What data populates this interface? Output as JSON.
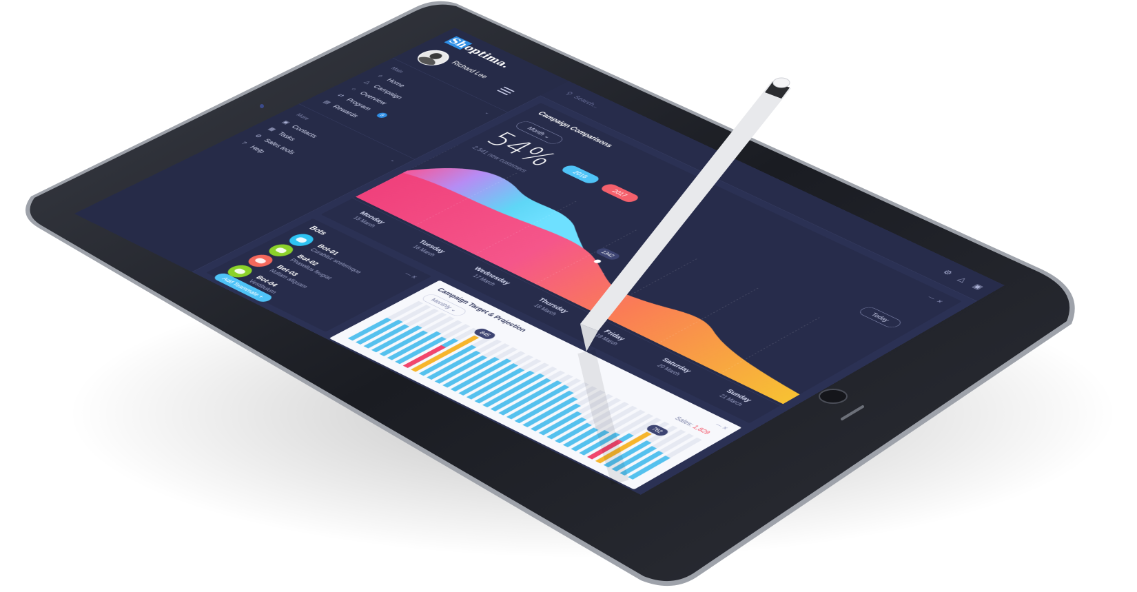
{
  "app": {
    "logo_prefix": "Sh",
    "logo_suffix": "optima.",
    "user_name": "Richard Lee"
  },
  "search": {
    "placeholder": "Search..."
  },
  "sidebar": {
    "main_label": "Main",
    "main_items": [
      {
        "label": "Home",
        "icon": "home-icon"
      },
      {
        "label": "Campaign",
        "icon": "megaphone-icon"
      },
      {
        "label": "Overview",
        "icon": "chat-icon"
      },
      {
        "label": "Program",
        "icon": "program-icon",
        "badge": "9"
      },
      {
        "label": "Rewards",
        "icon": "rewards-icon"
      }
    ],
    "more_label": "More",
    "more_items": [
      {
        "label": "Contacts",
        "icon": "folder-icon"
      },
      {
        "label": "Tasks",
        "icon": "tasks-icon"
      },
      {
        "label": "Sales tools",
        "icon": "tools-icon"
      },
      {
        "label": "Help",
        "icon": "help-icon"
      }
    ]
  },
  "comparison": {
    "title": "Campaign Comparisons",
    "period": "Month",
    "percent": "54%",
    "subtitle": "2,541 new customers",
    "legend_a": "2016",
    "legend_b": "2017",
    "point_label": "1342",
    "today_label": "Today",
    "days": [
      {
        "name": "Monday",
        "date": "15 March"
      },
      {
        "name": "Tuesday",
        "date": "16 March"
      },
      {
        "name": "Wednesday",
        "date": "17 March"
      },
      {
        "name": "Thursday",
        "date": "18 March"
      },
      {
        "name": "Friday",
        "date": "19 March"
      },
      {
        "name": "Saturday",
        "date": "20 March"
      },
      {
        "name": "Sunday",
        "date": "21 March"
      }
    ]
  },
  "bots": {
    "title": "Bots",
    "items": [
      {
        "name": "Bot-01",
        "desc": "Curabitur scelerisque",
        "color": "#2ec2f2"
      },
      {
        "name": "Bot-02",
        "desc": "Phasellus feugiat",
        "color": "#8bd12a"
      },
      {
        "name": "Bot-03",
        "desc": "Nullam aliquam",
        "color": "#f4685c"
      },
      {
        "name": "Bot-04",
        "desc": "Vestibulum",
        "color": "#8bd12a"
      }
    ],
    "add_label": "Add Teammate",
    "add_plus": "+"
  },
  "target": {
    "title": "Campaign Target & Projection",
    "period": "Monthly",
    "sales_label": "Sales:",
    "sales_value": "1,829",
    "peak_a": "845",
    "peak_b": "762",
    "bar_levels": [
      0.55,
      0.6,
      0.58,
      0.65,
      0.62,
      0.7,
      0.66,
      0.72,
      0.9,
      0.75,
      0.7,
      0.68,
      0.74,
      0.8,
      0.78,
      0.76,
      0.79,
      0.82,
      0.8,
      0.84,
      0.83,
      0.78,
      0.72,
      0.65,
      0.55,
      0.5,
      0.46,
      0.44,
      0.48,
      0.52,
      0.6,
      0.74,
      0.62,
      0.58,
      0.56,
      0.54
    ],
    "highlight_a": 8,
    "highlight_b": 31
  },
  "colors": {
    "screen_bg": "#2b3154",
    "accent_blue": "#2f8fe6",
    "pill_2016": "#4fc3f7",
    "pill_2017": "#f4606c",
    "sales_value": "#f4485c",
    "bar_blue": "#55c1ee",
    "bar_orange": "#f6b52c",
    "bar_pink": "#f2456c"
  }
}
